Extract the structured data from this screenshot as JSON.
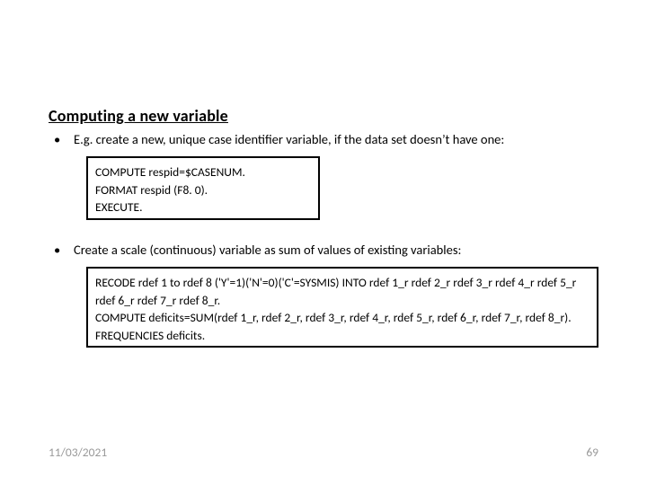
{
  "title": "Computing a new variable",
  "bullets": {
    "b1_text": "E.g. create a new, unique case identifier variable, if the data set doesn’t have one:",
    "b2_text": "Create a scale (continuous) variable as sum of values of existing variables:"
  },
  "code1": {
    "l1": "COMPUTE respid=$CASENUM.",
    "l2": "FORMAT respid (F8. 0).",
    "l3": "EXECUTE."
  },
  "code2": {
    "l1": "RECODE rdef 1 to rdef 8  ('Y'=1)('N'=0)('C'=SYSMIS) INTO rdef 1_r  rdef 2_r rdef 3_r rdef 4_r rdef 5_r rdef 6_r rdef 7_r  rdef 8_r.",
    "l2": "COMPUTE deficits=SUM(rdef 1_r, rdef 2_r, rdef 3_r, rdef 4_r, rdef 5_r, rdef 6_r, rdef 7_r, rdef 8_r).",
    "l3": "FREQUENCIES deficits."
  },
  "footer": {
    "date": "11/03/2021",
    "page": "69"
  },
  "bullet_char": "•"
}
